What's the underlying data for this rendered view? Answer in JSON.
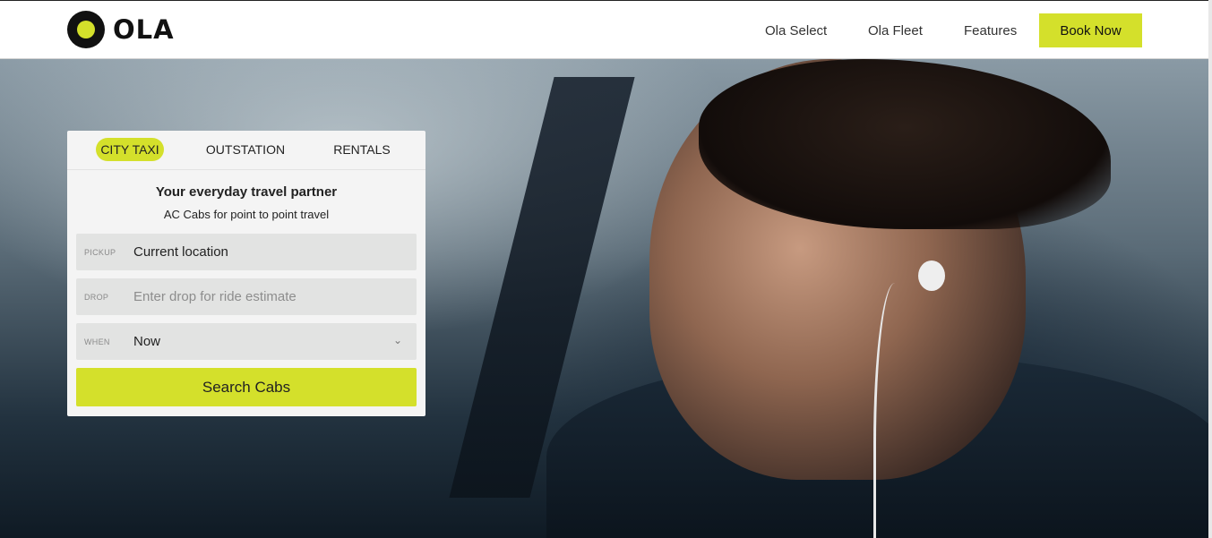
{
  "brand": {
    "logo_text": "OLA",
    "accent": "#d4e02b"
  },
  "nav": {
    "items": [
      {
        "label": "Ola Select"
      },
      {
        "label": "Ola Fleet"
      },
      {
        "label": "Features"
      }
    ],
    "cta_label": "Book Now"
  },
  "booking": {
    "tabs": [
      {
        "label": "CITY TAXI",
        "active": true
      },
      {
        "label": "OUTSTATION",
        "active": false
      },
      {
        "label": "RENTALS",
        "active": false
      }
    ],
    "title": "Your everyday travel partner",
    "subtitle": "AC Cabs for point to point travel",
    "pickup": {
      "label": "PICKUP",
      "value": "Current location"
    },
    "drop": {
      "label": "DROP",
      "placeholder": "Enter drop for ride estimate"
    },
    "when": {
      "label": "WHEN",
      "value": "Now"
    },
    "search_label": "Search Cabs"
  }
}
